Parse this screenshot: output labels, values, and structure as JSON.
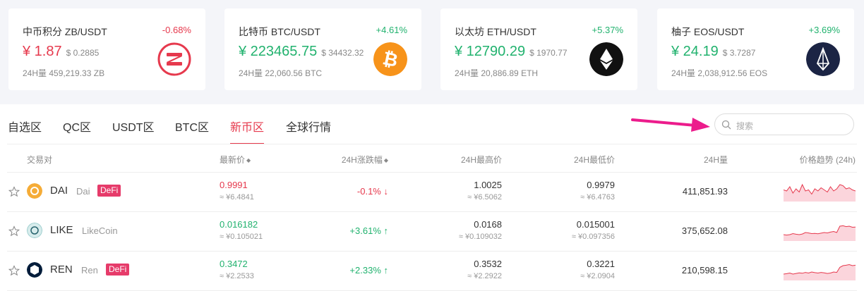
{
  "cards": [
    {
      "pair": "中币积分 ZB/USDT",
      "change": "-0.68%",
      "price": "¥ 1.87",
      "usd": "$ 0.2885",
      "volume": "24H量 459,219.33 ZB",
      "trend": "down",
      "icon": "zb-logo-icon",
      "color": "#e6394d"
    },
    {
      "pair": "比特币 BTC/USDT",
      "change": "+4.61%",
      "price": "¥ 223465.75",
      "usd": "$ 34432.32",
      "volume": "24H量 22,060.56 BTC",
      "trend": "up",
      "icon": "bitcoin-icon",
      "color": "#f7931a"
    },
    {
      "pair": "以太坊 ETH/USDT",
      "change": "+5.37%",
      "price": "¥ 12790.29",
      "usd": "$ 1970.77",
      "volume": "24H量 20,886.89 ETH",
      "trend": "up",
      "icon": "ethereum-icon",
      "color": "#111111"
    },
    {
      "pair": "柚子 EOS/USDT",
      "change": "+3.69%",
      "price": "¥ 24.19",
      "usd": "$ 3.7287",
      "volume": "24H量 2,038,912.56 EOS",
      "trend": "up",
      "icon": "eos-icon",
      "color": "#1b2444"
    }
  ],
  "tabs": [
    "自选区",
    "QC区",
    "USDT区",
    "BTC区",
    "新币区",
    "全球行情"
  ],
  "active_tab": 4,
  "search": {
    "placeholder": "搜索"
  },
  "table": {
    "headers": {
      "pair": "交易对",
      "last": "最新价",
      "change": "24H涨跌幅",
      "high": "24H最高价",
      "low": "24H最低价",
      "volume": "24H量",
      "trend": "价格趋势 (24h)"
    },
    "rows": [
      {
        "symbol": "DAI",
        "name": "Dai",
        "badge": "DeFi",
        "last": "0.9991",
        "last_cny": "≈ ¥6.4841",
        "change": "-0.1%",
        "trend": "down",
        "high": "1.0025",
        "high_cny": "≈ ¥6.5062",
        "low": "0.9979",
        "low_cny": "≈ ¥6.4763",
        "volume": "411,851.93",
        "spark": [
          0.55,
          0.5,
          0.7,
          0.4,
          0.6,
          0.45,
          0.8,
          0.5,
          0.55,
          0.35,
          0.6,
          0.5,
          0.65,
          0.55,
          0.45,
          0.7,
          0.5,
          0.6,
          0.8,
          0.75,
          0.6,
          0.65,
          0.55,
          0.5
        ]
      },
      {
        "symbol": "LIKE",
        "name": "LikeCoin",
        "badge": "",
        "last": "0.016182",
        "last_cny": "≈ ¥0.105021",
        "change": "+3.61%",
        "trend": "up",
        "high": "0.0168",
        "high_cny": "≈ ¥0.109032",
        "low": "0.015001",
        "low_cny": "≈ ¥0.097356",
        "volume": "375,652.08",
        "spark": [
          0.3,
          0.28,
          0.3,
          0.35,
          0.32,
          0.3,
          0.33,
          0.4,
          0.38,
          0.35,
          0.36,
          0.34,
          0.37,
          0.4,
          0.38,
          0.42,
          0.45,
          0.4,
          0.7,
          0.72,
          0.68,
          0.7,
          0.65,
          0.66
        ]
      },
      {
        "symbol": "REN",
        "name": "Ren",
        "badge": "DeFi",
        "last": "0.3472",
        "last_cny": "≈ ¥2.2533",
        "change": "+2.33%",
        "trend": "up",
        "high": "0.3532",
        "high_cny": "≈ ¥2.2922",
        "low": "0.3221",
        "low_cny": "≈ ¥2.0904",
        "volume": "210,598.15",
        "spark": [
          0.3,
          0.32,
          0.35,
          0.3,
          0.33,
          0.36,
          0.34,
          0.38,
          0.35,
          0.4,
          0.37,
          0.35,
          0.38,
          0.36,
          0.33,
          0.35,
          0.4,
          0.38,
          0.62,
          0.7,
          0.72,
          0.75,
          0.7,
          0.72
        ]
      }
    ]
  }
}
